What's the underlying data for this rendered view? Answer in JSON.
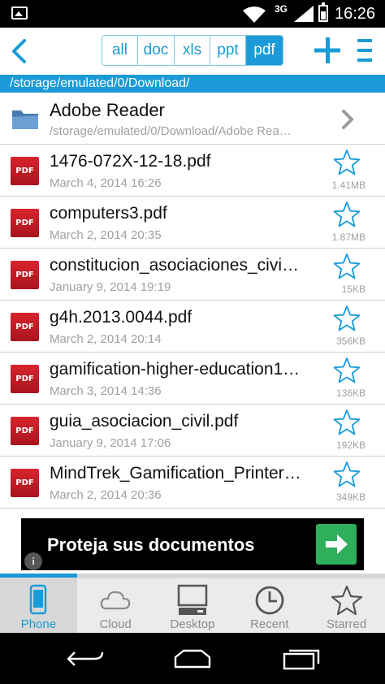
{
  "status_bar": {
    "network_type": "3G",
    "time": "16:26",
    "icons": [
      "gallery-icon",
      "wifi-icon",
      "signal-icon",
      "battery-icon"
    ]
  },
  "toolbar": {
    "back_icon": "back-chevron-icon",
    "filters": [
      {
        "label": "all",
        "active": false
      },
      {
        "label": "doc",
        "active": false
      },
      {
        "label": "xls",
        "active": false
      },
      {
        "label": "ppt",
        "active": false
      },
      {
        "label": "pdf",
        "active": true
      }
    ],
    "add_icon": "plus-icon",
    "menu_icon": "menu-icon"
  },
  "path_bar": {
    "path": "/storage/emulated/0/Download/"
  },
  "folder": {
    "name": "Adobe Reader",
    "path": "/storage/emulated/0/Download/Adobe Rea…"
  },
  "files": [
    {
      "name": "1476-072X-12-18.pdf",
      "date": "March 4, 2014 16:26",
      "size": "1.41MB",
      "icon": "PDF"
    },
    {
      "name": "computers3.pdf",
      "date": "March 2, 2014 20:35",
      "size": "1.87MB",
      "icon": "PDF"
    },
    {
      "name": "constitucion_asociaciones_civi…",
      "date": "January 9, 2014 19:19",
      "size": "15KB",
      "icon": "PDF"
    },
    {
      "name": "g4h.2013.0044.pdf",
      "date": "March 2, 2014 20:14",
      "size": "356KB",
      "icon": "PDF"
    },
    {
      "name": "gamification-higher-education1…",
      "date": "March 3, 2014 14:36",
      "size": "136KB",
      "icon": "PDF"
    },
    {
      "name": "guia_asociacion_civil.pdf",
      "date": "January 9, 2014 17:06",
      "size": "192KB",
      "icon": "PDF"
    },
    {
      "name": "MindTrek_Gamification_Printer…",
      "date": "March 2, 2014 20:36",
      "size": "349KB",
      "icon": "PDF"
    }
  ],
  "ad": {
    "text": "Proteja sus documentos",
    "info_glyph": "i",
    "arrow_color": "#2fae5b"
  },
  "progress": {
    "fraction": 0.2
  },
  "tabs": [
    {
      "label": "Phone",
      "icon": "phone-icon",
      "active": true
    },
    {
      "label": "Cloud",
      "icon": "cloud-icon",
      "active": false
    },
    {
      "label": "Desktop",
      "icon": "desktop-icon",
      "active": false
    },
    {
      "label": "Recent",
      "icon": "clock-icon",
      "active": false
    },
    {
      "label": "Starred",
      "icon": "star-icon",
      "active": false
    }
  ],
  "colors": {
    "accent": "#1a9bd7",
    "pdf_red": "#c81e27",
    "muted_text": "#a0a0a0"
  }
}
